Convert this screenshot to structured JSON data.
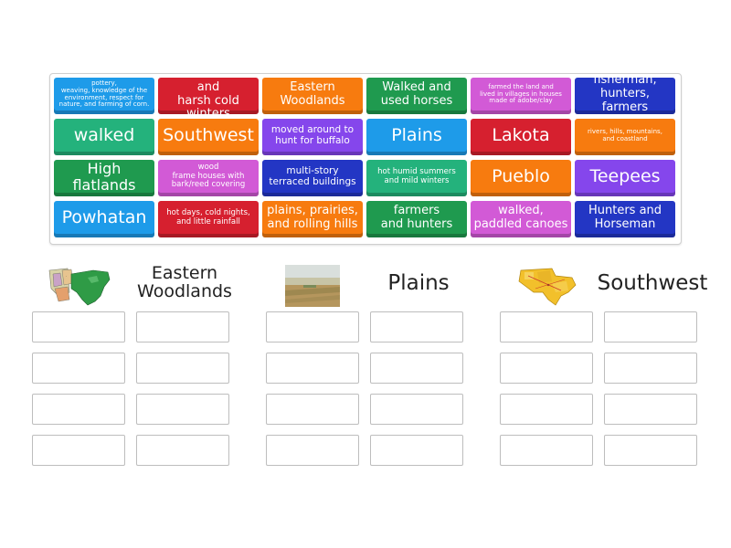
{
  "tiles": [
    {
      "text": "pottery,\nweaving, knowledge of the\nenvironment, respect for\nnature, and farming of corn.",
      "color": "#1e9be9"
    },
    {
      "text": "hot summers and\nharsh cold winters",
      "color": "#d6202f"
    },
    {
      "text": "Eastern\nWoodlands",
      "color": "#f77b0f"
    },
    {
      "text": "Walked and\nused horses",
      "color": "#1f9a4f"
    },
    {
      "text": "farmed the land and\nlived in villages in houses\nmade of adobe/clay",
      "color": "#d25ad6"
    },
    {
      "text": "fisherman,\nhunters, farmers",
      "color": "#2336c4"
    },
    {
      "text": "walked",
      "color": "#24b27c"
    },
    {
      "text": "Southwest",
      "color": "#f77b0f"
    },
    {
      "text": "moved around to\nhunt for buffalo",
      "color": "#8546ec"
    },
    {
      "text": "Plains",
      "color": "#1e9be9"
    },
    {
      "text": "Lakota",
      "color": "#d6202f"
    },
    {
      "text": "rivers, hills, mountains,\nand coastland",
      "color": "#f77b0f"
    },
    {
      "text": "High flatlands",
      "color": "#1f9a4f"
    },
    {
      "text": "wood\nframe houses with\nbark/reed covering",
      "color": "#d25ad6"
    },
    {
      "text": "multi-story\nterraced buildings",
      "color": "#2336c4"
    },
    {
      "text": "hot humid summers\nand mild winters",
      "color": "#24b27c"
    },
    {
      "text": "Pueblo",
      "color": "#f77b0f"
    },
    {
      "text": "Teepees",
      "color": "#8546ec"
    },
    {
      "text": "Powhatan",
      "color": "#1e9be9"
    },
    {
      "text": "hot days, cold nights,\nand little rainfall",
      "color": "#d6202f"
    },
    {
      "text": "plains, prairies,\nand rolling hills",
      "color": "#f77b0f"
    },
    {
      "text": "farmers\nand hunters",
      "color": "#1f9a4f"
    },
    {
      "text": "walked,\npaddled canoes",
      "color": "#d25ad6"
    },
    {
      "text": "Hunters and\nHorseman",
      "color": "#2336c4"
    }
  ],
  "categories": [
    {
      "title": "Eastern\nWoodlands",
      "image": "woodlands-region-map"
    },
    {
      "title": "Plains",
      "image": "plains-landscape-photo"
    },
    {
      "title": "Southwest",
      "image": "southwest-region-map"
    }
  ]
}
